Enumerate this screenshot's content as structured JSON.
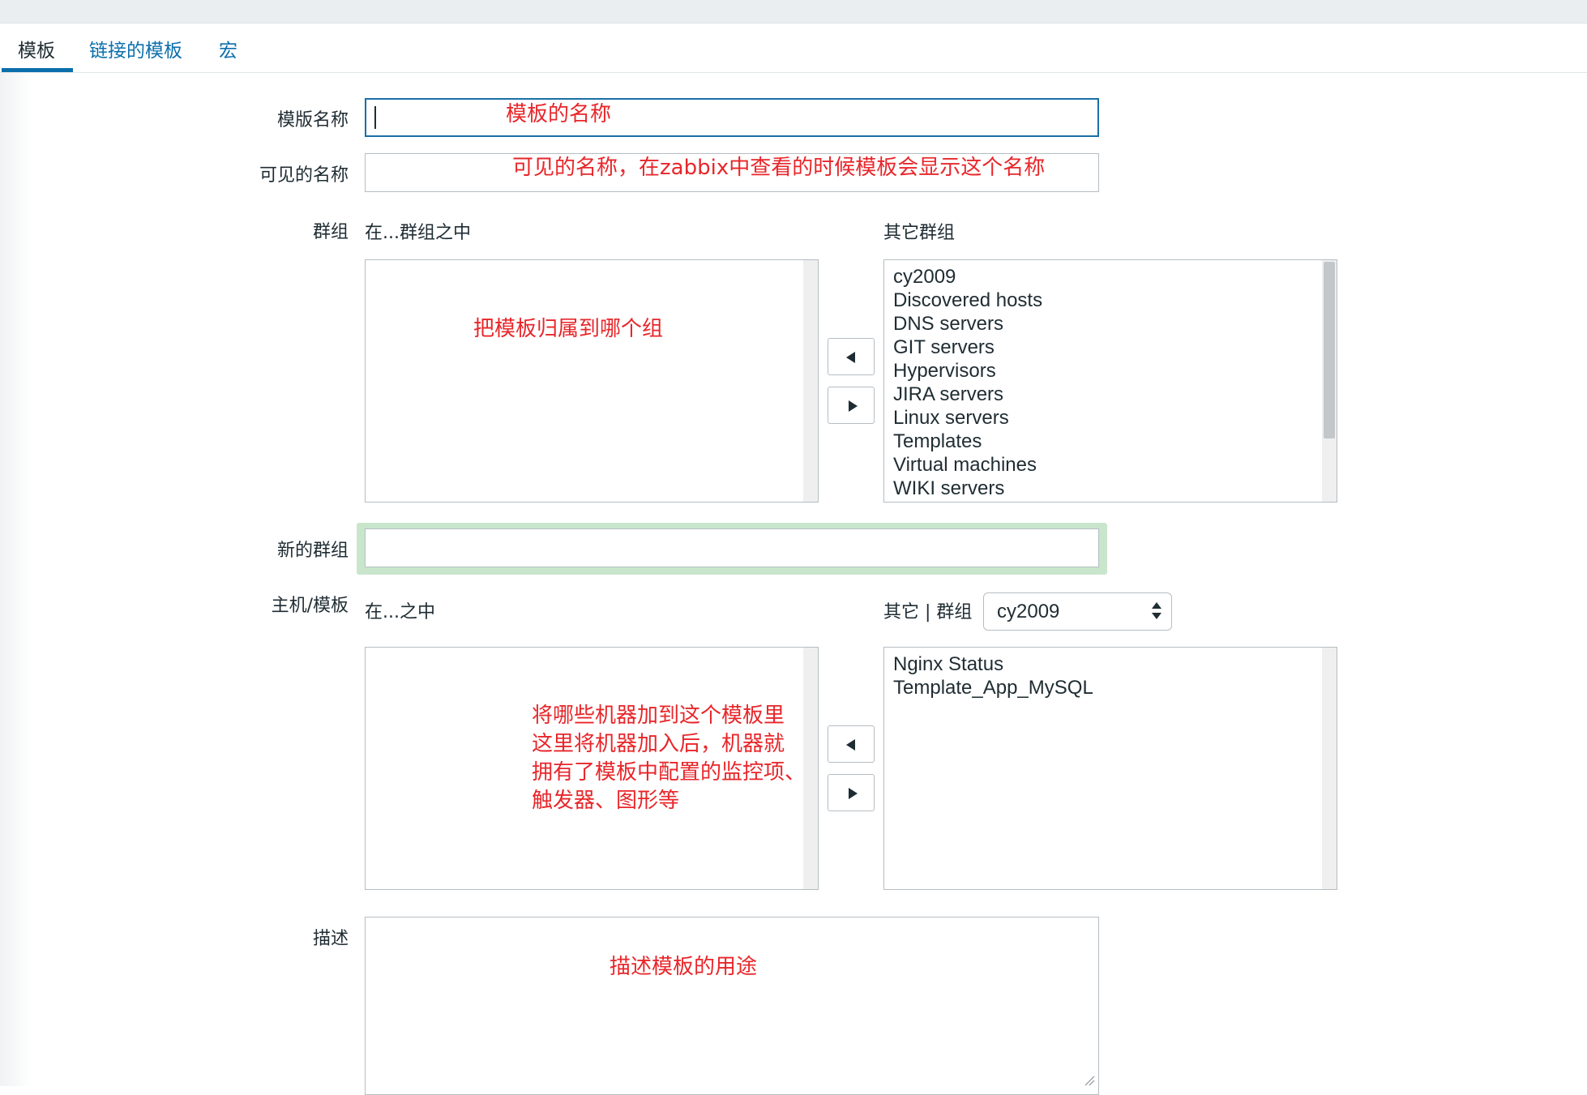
{
  "tabs": [
    {
      "label": "模板"
    },
    {
      "label": "链接的模板"
    },
    {
      "label": "宏"
    }
  ],
  "form": {
    "template_name": {
      "label": "模版名称",
      "value": "",
      "annotation": "模板的名称"
    },
    "visible_name": {
      "label": "可见的名称",
      "value": "",
      "annotation": "可见的名称，在zabbix中查看的时候模板会显示这个名称"
    },
    "groups": {
      "label": "群组",
      "in_label": "在...群组之中",
      "other_label": "其它群组",
      "annotation": "把模板归属到哪个组",
      "in_items": [],
      "other_items": [
        "cy2009",
        "Discovered hosts",
        "DNS servers",
        "GIT servers",
        "Hypervisors",
        "JIRA servers",
        "Linux servers",
        "Templates",
        "Virtual machines",
        "WIKI servers"
      ]
    },
    "new_group": {
      "label": "新的群组",
      "value": ""
    },
    "hosts": {
      "label": "主机/模板",
      "in_label": "在...之中",
      "other_label": "其它 | 群组",
      "group_select": "cy2009",
      "annotation_lines": [
        "将哪些机器加到这个模板里",
        "这里将机器加入后，机器就",
        "拥有了模板中配置的监控项、",
        "触发器、图形等"
      ],
      "in_items": [],
      "other_items": [
        "Nginx Status",
        "Template_App_MySQL"
      ]
    },
    "description": {
      "label": "描述",
      "value": "",
      "annotation": "描述模板的用途"
    }
  },
  "colors": {
    "link": "#0b6fac",
    "annotation": "#e8262a",
    "focus_border": "#1a6fa6",
    "highlight": "#c9e6cc"
  }
}
